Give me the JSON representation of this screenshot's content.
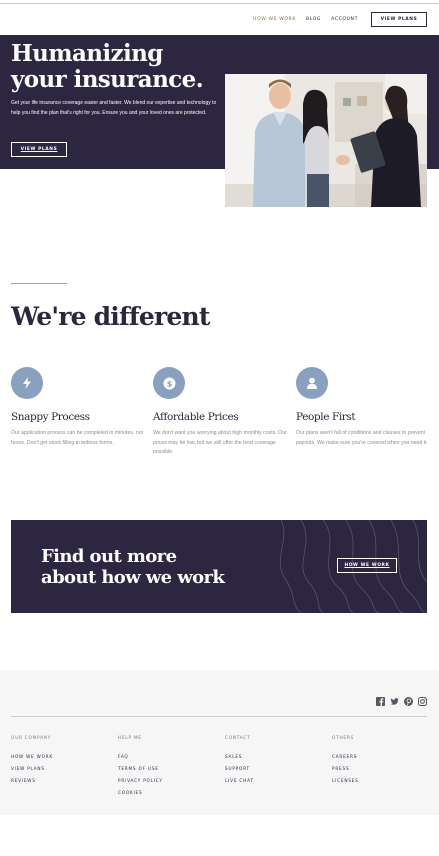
{
  "header": {
    "nav": [
      {
        "label": "HOW WE WORK",
        "active": true
      },
      {
        "label": "BLOG",
        "active": false
      },
      {
        "label": "ACCOUNT",
        "active": false
      }
    ],
    "cta_label": "VIEW PLANS"
  },
  "hero": {
    "title_line1": "Humanizing",
    "title_line2": "your insurance.",
    "body": "Get your life insurance coverage easier and faster. We blend our expertise and technology to help you find the plan that's right for you. Ensure you and your loved ones are protected.",
    "cta_label": "VIEW PLANS"
  },
  "different": {
    "title": "We're different",
    "features": [
      {
        "icon": "lightning-icon",
        "title": "Snappy Process",
        "body": "Our application process can be completed in minutes, not hours. Don't get stuck filling in tedious forms."
      },
      {
        "icon": "dollar-coin-icon",
        "title": "Affordable Prices",
        "body": "We don't want you worrying about high monthly costs. Our prices may be low, but we still offer the best coverage possible."
      },
      {
        "icon": "person-icon",
        "title": "People First",
        "body": "Our plans aren't full of conditions and clauses to prevent payouts. We make sure you're covered when you need it."
      }
    ]
  },
  "banner": {
    "title_line1": "Find out more",
    "title_line2": "about how we work",
    "cta_label": "HOW WE WORK"
  },
  "footer": {
    "social": [
      "facebook-icon",
      "twitter-icon",
      "pinterest-icon",
      "instagram-icon"
    ],
    "columns": [
      {
        "heading": "OUR COMPANY",
        "links": [
          "HOW WE WORK",
          "VIEW PLANS",
          "REVIEWS"
        ]
      },
      {
        "heading": "HELP ME",
        "links": [
          "FAQ",
          "TERMS OF USE",
          "PRIVACY POLICY",
          "COOKIES"
        ]
      },
      {
        "heading": "CONTACT",
        "links": [
          "SALES",
          "SUPPORT",
          "LIVE CHAT"
        ]
      },
      {
        "heading": "OTHERS",
        "links": [
          "CAREERS",
          "PRESS",
          "LICENSES"
        ]
      }
    ]
  },
  "colors": {
    "brand_dark": "#2d2640",
    "icon_blue": "#8aa0bf",
    "accent_line": "#b690b8",
    "nav_active": "#8a6d4a"
  }
}
